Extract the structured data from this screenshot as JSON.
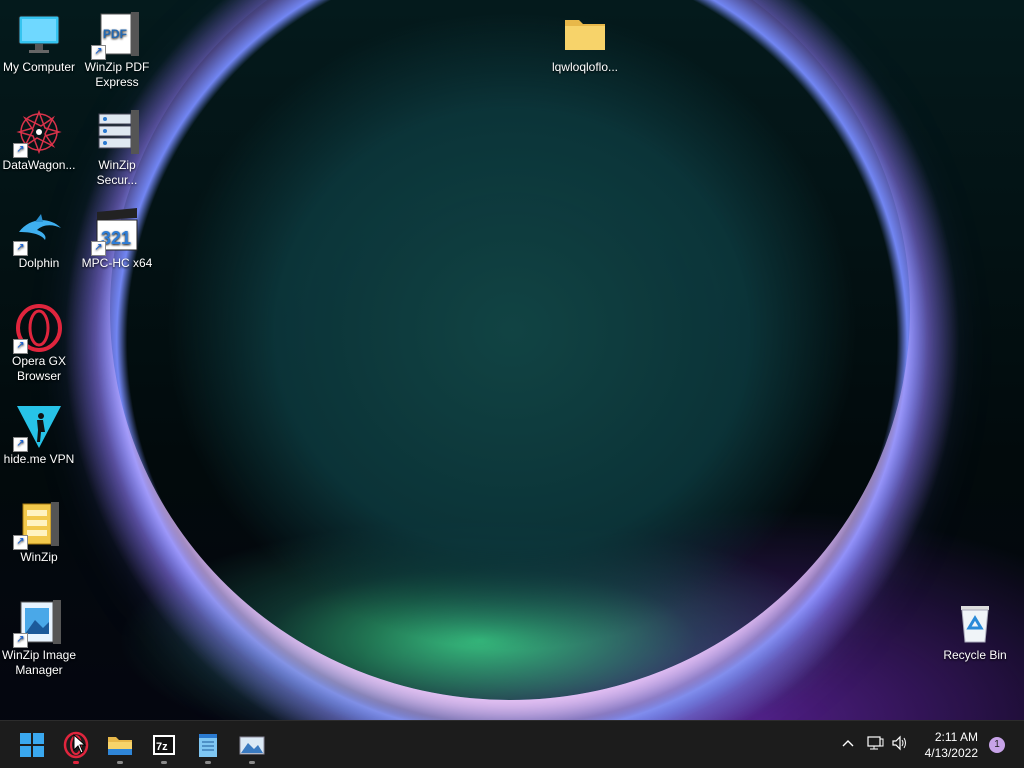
{
  "desktop": {
    "icons": [
      {
        "label": "My Computer",
        "icon": "monitor-icon"
      },
      {
        "label": "WinZip PDF Express",
        "icon": "pdf-icon"
      },
      {
        "label": "DataWagon...",
        "icon": "datawagon-icon"
      },
      {
        "label": "WinZip Secur...",
        "icon": "server-icon"
      },
      {
        "label": "Dolphin",
        "icon": "dolphin-icon"
      },
      {
        "label": "MPC-HC x64",
        "icon": "clapperboard-icon"
      },
      {
        "label": "Opera GX Browser",
        "icon": "opera-icon"
      },
      {
        "label": "hide.me VPN",
        "icon": "vpn-icon"
      },
      {
        "label": "WinZip",
        "icon": "winzip-icon"
      },
      {
        "label": "WinZip Image Manager",
        "icon": "image-manager-icon"
      },
      {
        "label": "lqwloqloflo...",
        "icon": "folder-icon"
      },
      {
        "label": "Recycle Bin",
        "icon": "recycle-bin-icon"
      }
    ]
  },
  "taskbar": {
    "apps": [
      "start-icon",
      "opera-icon",
      "file-explorer-icon",
      "7zip-icon",
      "notepad-icon",
      "image-viewer-icon"
    ],
    "time": "2:11 AM",
    "date": "4/13/2022",
    "notification_count": "1"
  }
}
